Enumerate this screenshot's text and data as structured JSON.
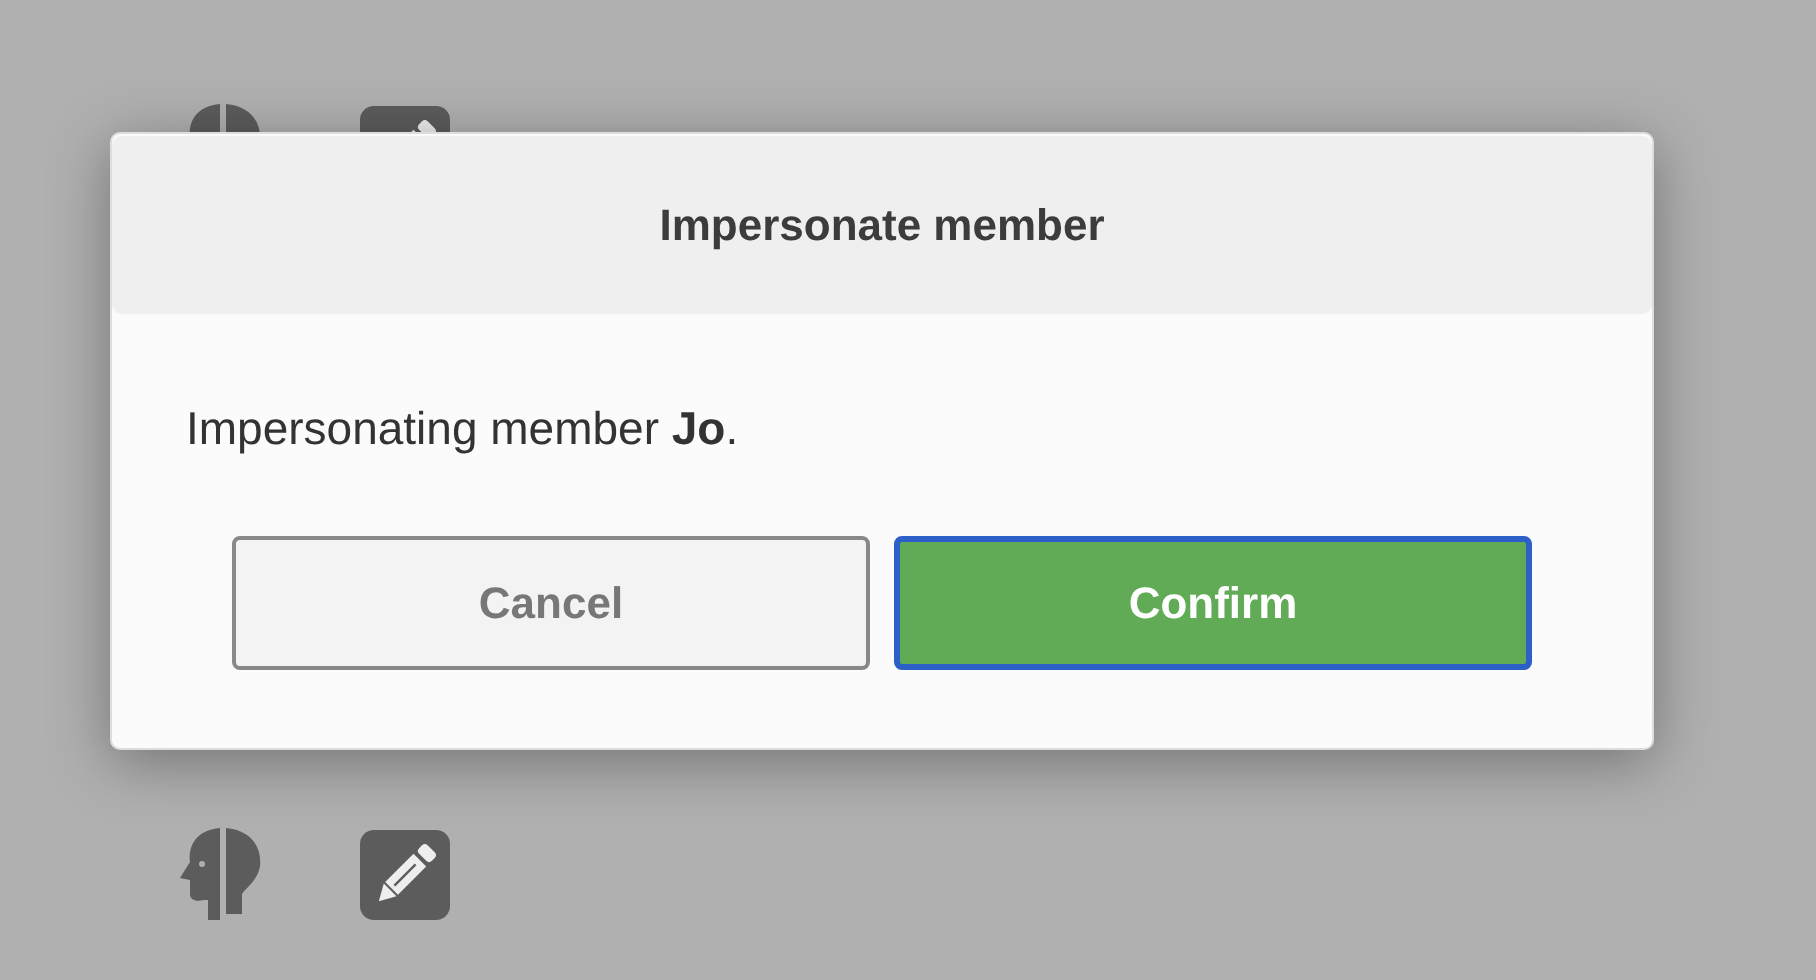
{
  "dialog": {
    "title": "Impersonate member",
    "message": "Impersonating member **Jo**.",
    "buttons": [
      {
        "label": "Cancel",
        "kind": "secondary",
        "focused": false
      },
      {
        "label": "Confirm",
        "kind": "primary",
        "focused": true
      }
    ]
  }
}
